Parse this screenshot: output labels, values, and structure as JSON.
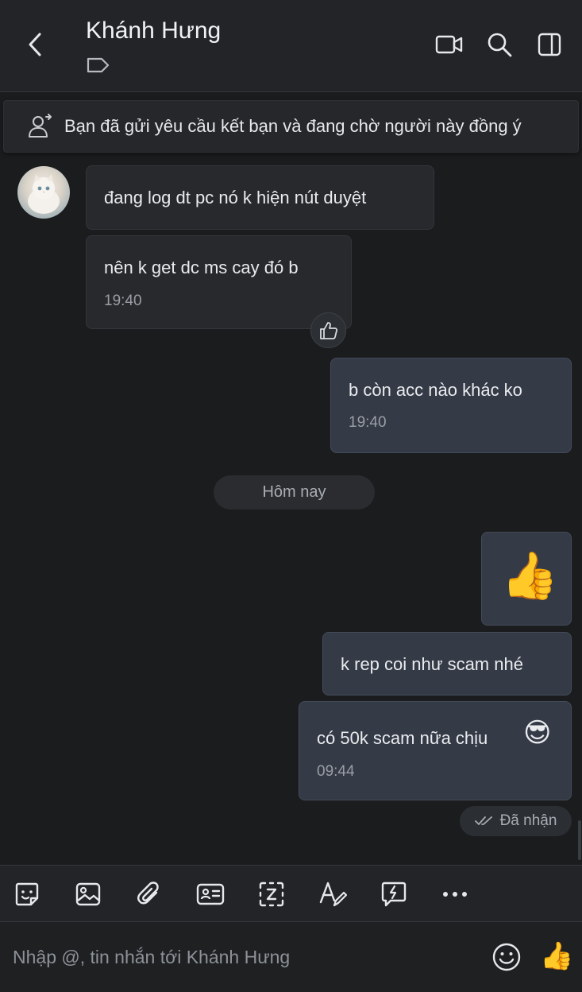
{
  "header": {
    "contact_name": "Khánh Hưng"
  },
  "banner": {
    "text": "Bạn đã gửi yêu cầu kết bạn và đang chờ người này đồng ý"
  },
  "messages": [
    {
      "direction": "in",
      "text": "đang log dt pc nó k hiện nút duyệt"
    },
    {
      "direction": "in",
      "text": "nên k get dc ms cay đó b",
      "time": "19:40"
    },
    {
      "direction": "out",
      "text": "b còn acc nào khác ko",
      "time": "19:40"
    },
    {
      "direction": "out",
      "emoji": "👍"
    },
    {
      "direction": "out",
      "text": "k rep coi như scam nhé"
    },
    {
      "direction": "out",
      "text": "có 50k scam nữa chịu",
      "emoji": "😎",
      "time": "09:44"
    }
  ],
  "date_divider": "Hôm nay",
  "delivery_status": "Đã nhận",
  "toolbar": {
    "icons": [
      "sticker-icon",
      "image-icon",
      "attachment-icon",
      "contact-card-icon",
      "screenshot-icon",
      "text-format-icon",
      "quick-message-icon",
      "more-icon"
    ]
  },
  "composer": {
    "placeholder": "Nhập @, tin nhắn tới Khánh Hưng",
    "value": "",
    "like_emoji": "👍"
  },
  "colors": {
    "background": "#1b1c1e",
    "incoming_bubble": "#27292d",
    "outgoing_bubble": "#343a46",
    "header": "#222427"
  }
}
